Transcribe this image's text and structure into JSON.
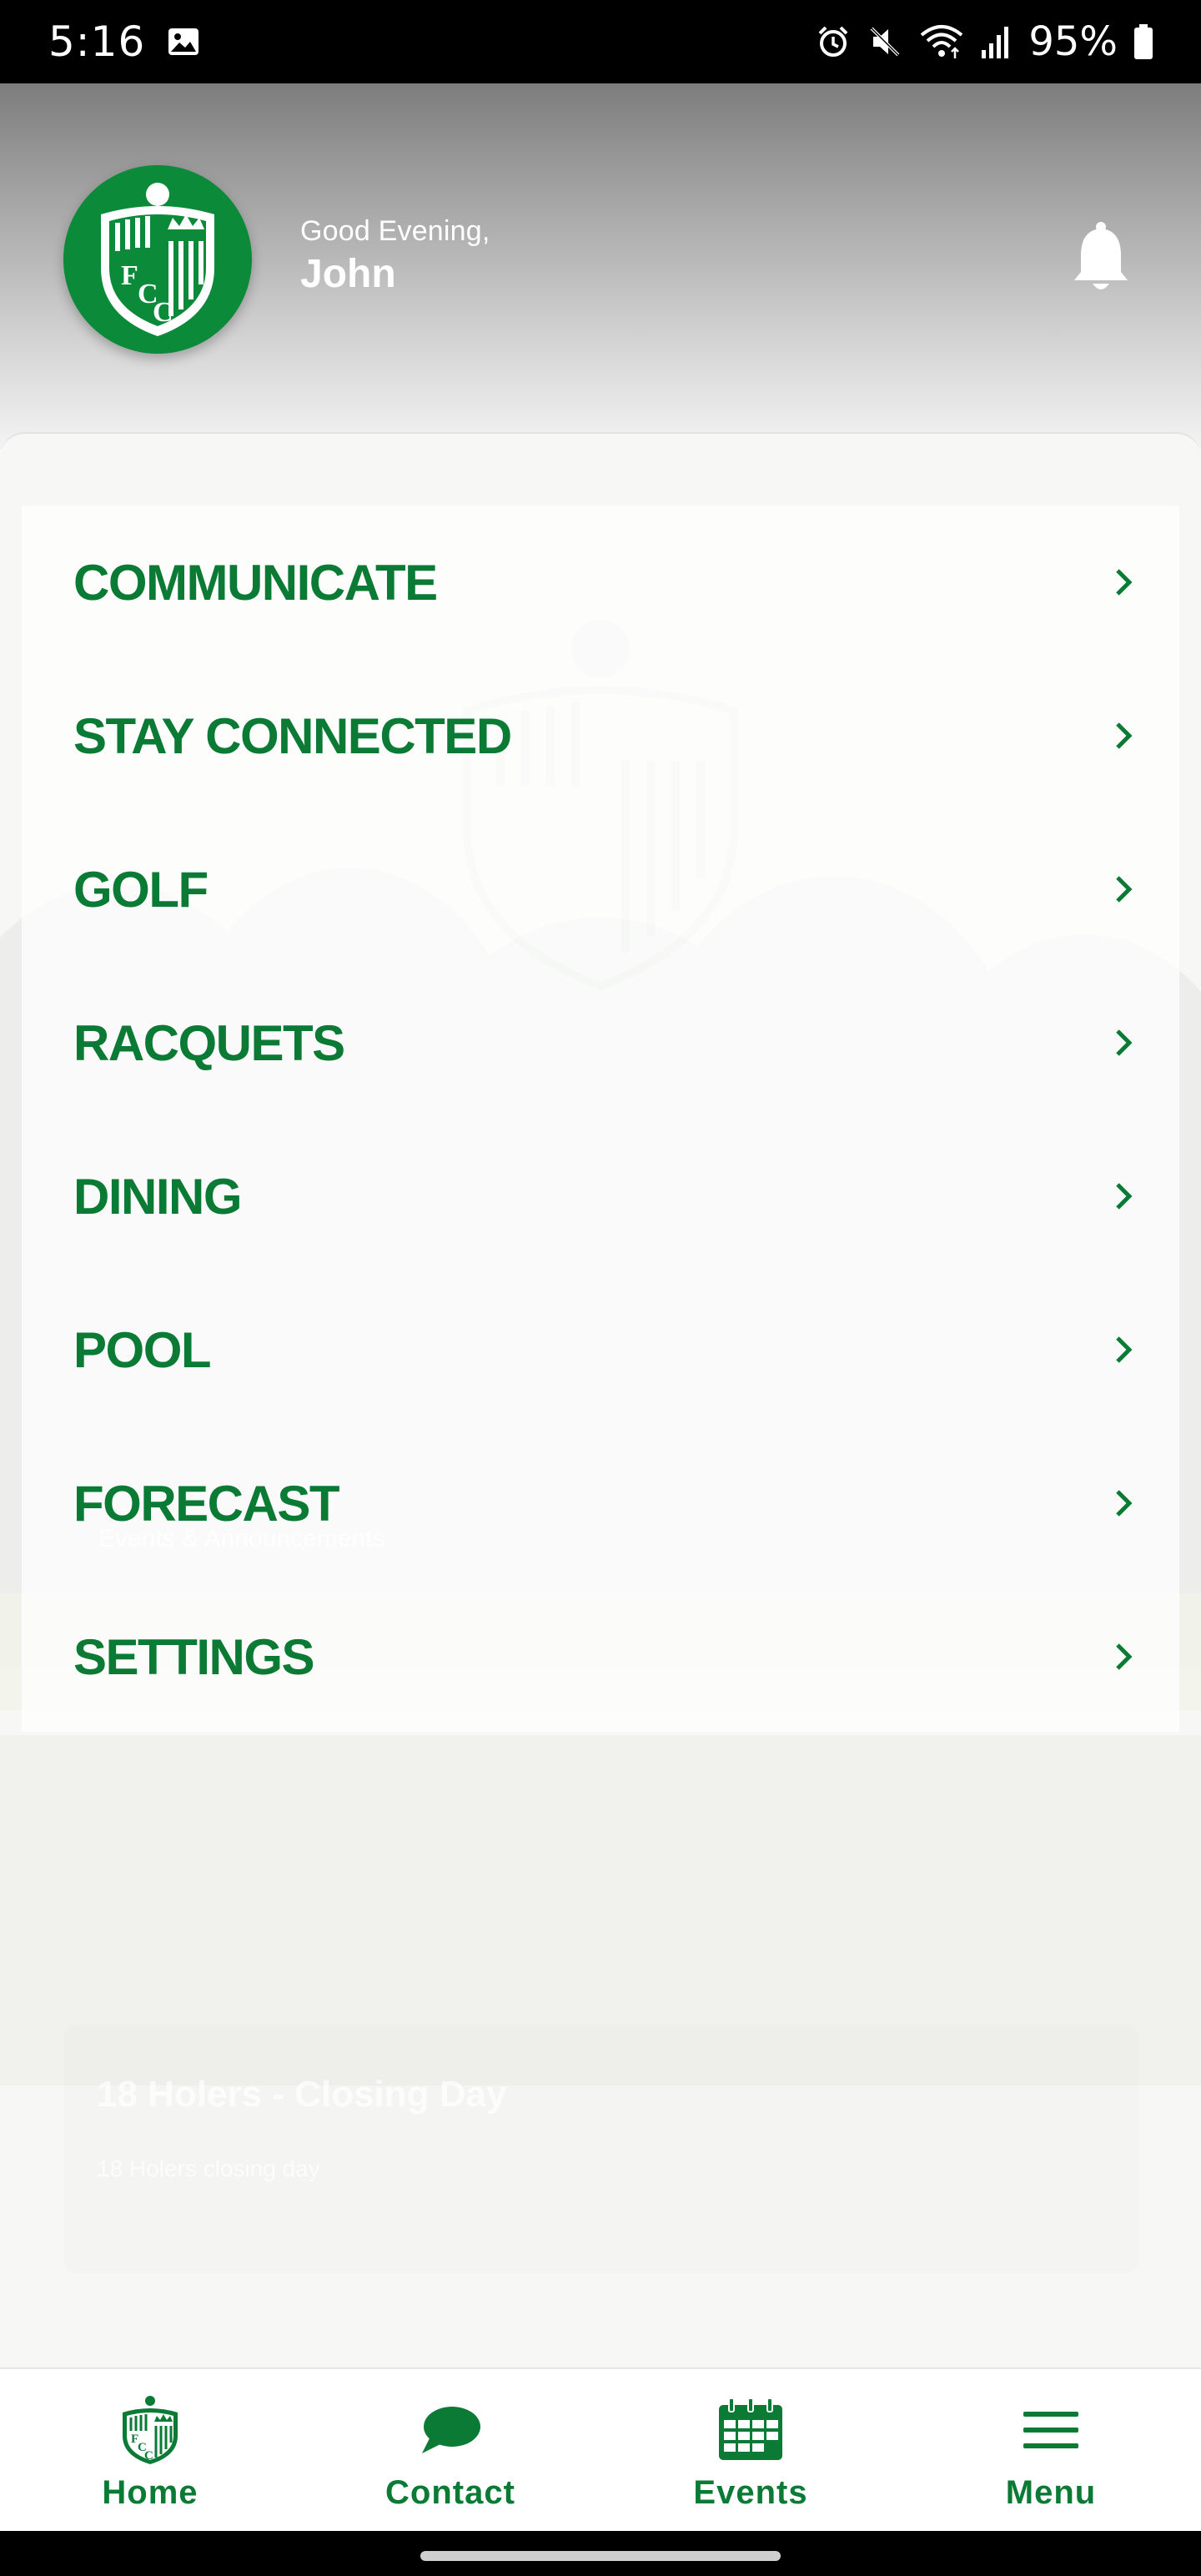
{
  "status_bar": {
    "time": "5:16",
    "battery_percent": "95%",
    "icons": [
      "gallery-icon",
      "alarm-icon",
      "mute-icon",
      "wifi-icon",
      "signal-icon",
      "battery-icon"
    ]
  },
  "header": {
    "greeting": "Good Evening,",
    "user_name": "John",
    "logo_text": "FCC",
    "notification_icon": "bell-icon"
  },
  "menu": {
    "items": [
      {
        "label": "COMMUNICATE",
        "icon": "chevron-right-icon"
      },
      {
        "label": "STAY CONNECTED",
        "icon": "chevron-right-icon"
      },
      {
        "label": "GOLF",
        "icon": "chevron-right-icon"
      },
      {
        "label": "RACQUETS",
        "icon": "chevron-right-icon"
      },
      {
        "label": "DINING",
        "icon": "chevron-right-icon"
      },
      {
        "label": "POOL",
        "icon": "chevron-right-icon"
      },
      {
        "label": "FORECAST",
        "icon": "chevron-right-icon"
      },
      {
        "label": "SETTINGS",
        "icon": "chevron-right-icon"
      }
    ]
  },
  "background": {
    "section_label": "Events & Announcements",
    "card_title": "18 Holers - Closing Day",
    "card_body": "18 Holers closing day"
  },
  "bottom_nav": {
    "items": [
      {
        "label": "Home",
        "icon": "club-logo-icon"
      },
      {
        "label": "Contact",
        "icon": "chat-bubble-icon"
      },
      {
        "label": "Events",
        "icon": "calendar-icon"
      },
      {
        "label": "Menu",
        "icon": "hamburger-menu-icon"
      }
    ]
  },
  "colors": {
    "brand_green": "#0a7a35",
    "logo_green": "#0b8a3a",
    "status_bar": "#000000"
  }
}
